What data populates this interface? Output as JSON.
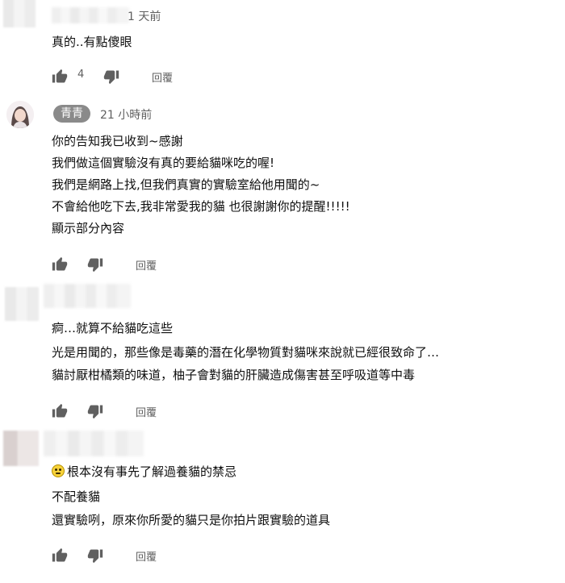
{
  "comments": [
    {
      "time": "1 天前",
      "lines": [
        "真的..有點傻眼"
      ],
      "likes": "4",
      "reply_label": "回覆"
    },
    {
      "author": "青青",
      "time": "21 小時前",
      "lines": [
        "你的告知我已收到~感謝",
        "我們做這個實驗沒有真的要給貓咪吃的喔!",
        "我們是網路上找,但我們真實的實驗室給他用聞的~",
        "不會給他吃下去,我非常愛我的貓 也很謝謝你的提醒!!!!!",
        "顯示部分內容"
      ],
      "reply_label": "回覆"
    },
    {
      "lines": [
        "痾…就算不給貓吃這些",
        "光是用聞的，那些像是毒藥的潛在化學物質對貓咪來說就已經很致命了…",
        "貓討厭柑橘類的味道，柚子會對貓的肝臟造成傷害甚至呼吸道等中毒"
      ],
      "reply_label": "回覆"
    },
    {
      "lines": [
        "根本沒有事先了解過養貓的禁忌",
        "不配養貓",
        "還實驗咧，原來你所愛的貓只是你拍片跟實驗的道具"
      ],
      "reply_label": "回覆"
    }
  ]
}
